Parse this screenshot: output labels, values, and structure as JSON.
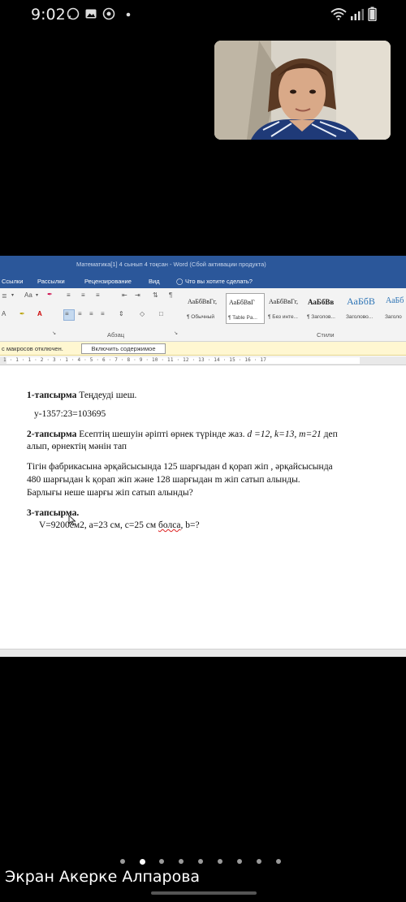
{
  "status_bar": {
    "time": "9:02",
    "left_icons": [
      "whatsapp-icon",
      "gallery-icon",
      "chrome-icon",
      "dot-icon"
    ],
    "right_icons": [
      "wifi-icon",
      "signal-icon",
      "battery-icon"
    ]
  },
  "word": {
    "title": "Математика[1] 4 сынып 4 тоқсан - Word (Сбой активации продукта)",
    "menu": [
      "Ссылки",
      "Рассылки",
      "Рецензирование",
      "Вид",
      "Что вы хотите сделать?"
    ],
    "ribbon": {
      "group_paragraph": "Абзац",
      "group_styles": "Стили",
      "styles": [
        {
          "preview": "АаБбВвГг,",
          "name": "¶ Обычный"
        },
        {
          "preview": "АаБбВвГ",
          "name": "¶ Table Pa..."
        },
        {
          "preview": "АаБбВвГг,",
          "name": "¶ Без инте..."
        },
        {
          "preview": "АаБбВв",
          "name": "¶ Заголов..."
        },
        {
          "preview": "АаБбВ",
          "name": "Заголово..."
        },
        {
          "preview": "АаБб",
          "name": "Заголо"
        }
      ]
    },
    "message_bar": {
      "text": "с макросов отключен.",
      "button": "Включить содержимое"
    },
    "ruler": "1 · 1 · 1 · 2 · 3 · 1 · 4 · 5 · 6 · 7 · 8 · 9 · 10 · 11 · 12 · 13 · 14 · 15 · 16 · 17",
    "document": {
      "task1_title": "1-тапсырма",
      "task1_text": " Теңдеуді шеш.",
      "equation": "у-1357:23=103695",
      "task2_title": "2-тапсырма",
      "task2_text": " Есептің шешуін әріпті өрнек түрінде жаз. ",
      "task2_vars": "d =12, k=13, m=21",
      "task2_tail": " деп",
      "task2_line2": "алып, өрнектің мәнін тап",
      "problem_line1": "Тігін фабрикасына әрқайсысында 125 шарғыдан  d қорап жіп , әрқайсысында",
      "problem_line2": "480 шарғыдан  k қорап жіп және 128 шарғыдан m жіп сатып алынды.",
      "problem_line3": "Барлығы неше шарғы жіп сатып алынды?",
      "task3_title": "3-тапсырма.",
      "task3_pre": "V=9200см2, а=23 см, с=25 см ",
      "task3_word": "болса",
      "task3_post": ", b=?"
    }
  },
  "participant_name": "Экран Акерке Алпарова",
  "pager": {
    "count": 9,
    "active_index": 1
  }
}
